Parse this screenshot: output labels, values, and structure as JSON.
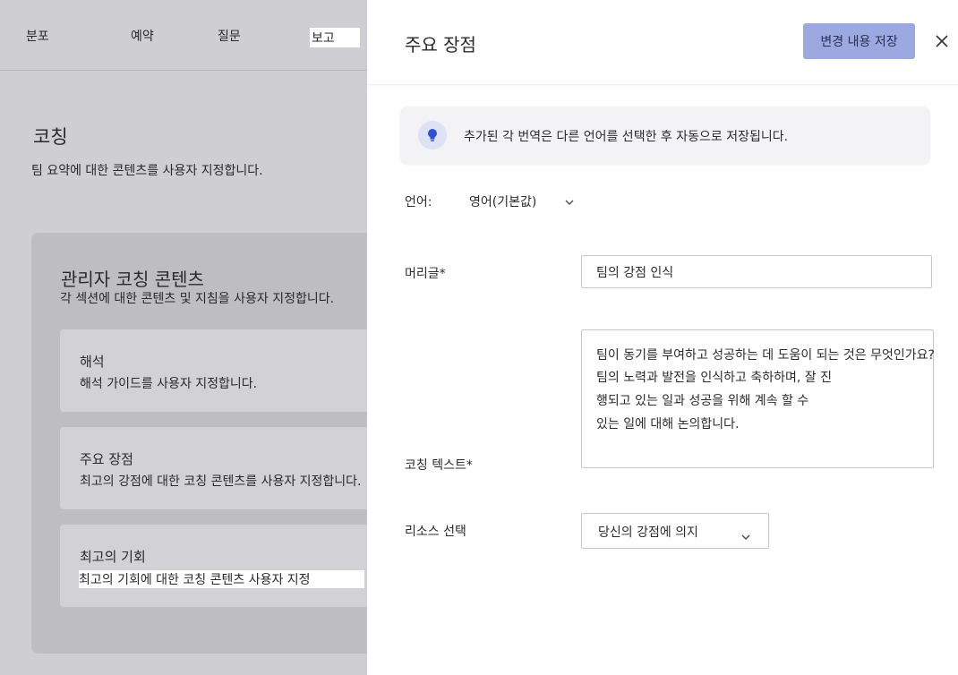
{
  "background": {
    "nav": [
      "분포",
      "예약",
      "질문",
      "보고"
    ],
    "section_title": "코칭",
    "section_subtitle": "팀 요약에 대한 콘텐츠를 사용자 지정합니다.",
    "coaching_panel": {
      "title": "관리자 코칭 콘텐츠",
      "subtitle": "각 섹션에 대한 콘텐츠 및 지침을 사용자 지정합니다.",
      "cards": [
        {
          "title": "해석",
          "subtitle": "해석 가이드를 사용자 지정합니다."
        },
        {
          "title": "주요 장점",
          "subtitle": "최고의 강점에 대한 코칭 콘텐츠를 사용자 지정합니다."
        },
        {
          "title": "최고의 기회",
          "subtitle": "최고의 기회에 대한 코칭 콘텐츠 사용자 지정"
        }
      ]
    }
  },
  "drawer": {
    "title": "주요 장점",
    "save_label": "변경 내용 저장",
    "info_text": "추가된 각 번역은 다른 언어를 선택한 후 자동으로 저장됩니다.",
    "language_label": "언어:",
    "language_value": "영어(기본값)",
    "heading_label": "머리글*",
    "heading_value": "팀의 강점 인식",
    "coaching_text_label": "코칭 텍스트*",
    "coaching_text_lines": [
      "팀이 동기를 부여하고 성공하는 데 도움이 되는 것은 무엇인가요?",
      "팀의 노력과 발전을 인식하고 축하하며, 잘 진",
      "행되고 있는 일과 성공을 위해 계속 할 수",
      "있는 일에 대해 논의합니다."
    ],
    "resource_label": "리소스 선택",
    "resource_value": "당신의 강점에 의지"
  },
  "colors": {
    "save_button_bg": "#9ba9e0",
    "overlay_bg": "#cfcfd3",
    "bulb_accent": "#2f4fd6"
  },
  "icons": {
    "info": "lightbulb-icon",
    "close": "close-icon",
    "dropdown": "chevron-down-icon"
  }
}
